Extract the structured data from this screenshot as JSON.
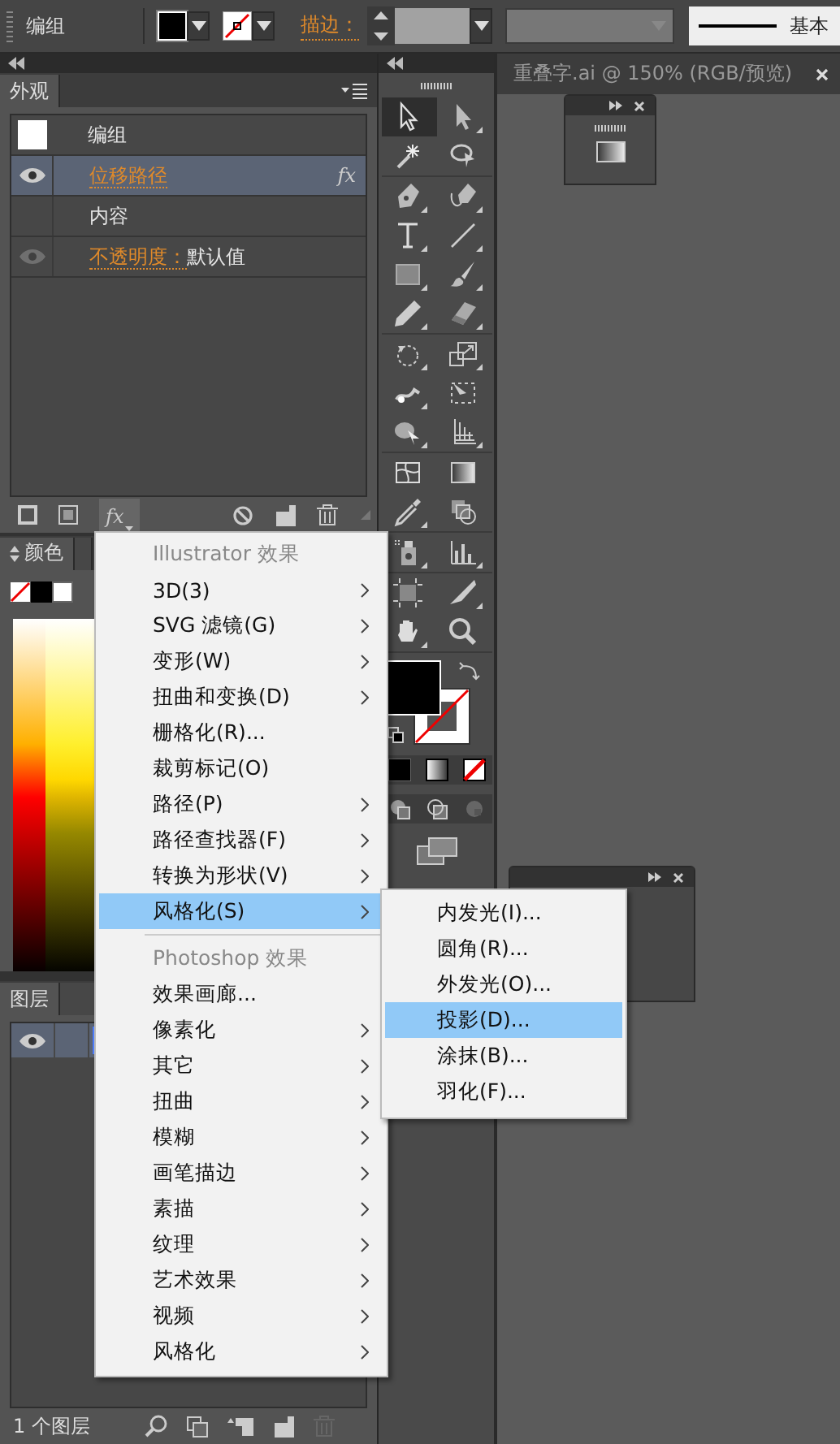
{
  "control_bar": {
    "selection_label": "编组",
    "stroke_label": "描边：",
    "stroke_style_label": "基本"
  },
  "appearance_panel": {
    "tab": "外观",
    "rows": [
      {
        "kind": "group",
        "label": "编组",
        "selected": false
      },
      {
        "kind": "effect",
        "label": "位移路径",
        "fx": "fx",
        "eye_dimmed": false,
        "selected": true
      },
      {
        "kind": "contents",
        "label": "内容",
        "selected": false
      },
      {
        "kind": "opacity",
        "label": "不透明度：",
        "value": "默认值",
        "eye_dimmed": true,
        "selected": false
      }
    ],
    "fx_button": "fx"
  },
  "color_panel": {
    "tab": "颜色"
  },
  "layers_panel": {
    "tab": "图层",
    "rows": [
      {
        "selected": true
      }
    ],
    "count": "1 个图层"
  },
  "toolbar": {
    "groups": [
      [
        {
          "kind": "selection",
          "selected": true,
          "flyout": false
        },
        {
          "kind": "direct-selection",
          "selected": false,
          "flyout": true
        },
        {
          "kind": "magic-wand",
          "selected": false,
          "flyout": false
        },
        {
          "kind": "lasso",
          "selected": false,
          "flyout": false
        }
      ],
      [
        {
          "kind": "pen",
          "selected": false,
          "flyout": true
        },
        {
          "kind": "curvature",
          "selected": false,
          "flyout": true
        },
        {
          "kind": "type",
          "selected": false,
          "flyout": true
        },
        {
          "kind": "line",
          "selected": false,
          "flyout": true
        },
        {
          "kind": "rectangle",
          "selected": false,
          "flyout": true
        },
        {
          "kind": "paintbrush",
          "selected": false,
          "flyout": true
        },
        {
          "kind": "pencil",
          "selected": false,
          "flyout": true
        },
        {
          "kind": "eraser",
          "selected": false,
          "flyout": true
        }
      ],
      [
        {
          "kind": "rotate",
          "selected": false,
          "flyout": true
        },
        {
          "kind": "scale",
          "selected": false,
          "flyout": true
        },
        {
          "kind": "width",
          "selected": false,
          "flyout": true
        },
        {
          "kind": "free-transform",
          "selected": false,
          "flyout": false
        },
        {
          "kind": "shape-builder",
          "selected": false,
          "flyout": true
        },
        {
          "kind": "perspective",
          "selected": false,
          "flyout": true
        }
      ],
      [
        {
          "kind": "mesh",
          "selected": false,
          "flyout": false
        },
        {
          "kind": "gradient",
          "selected": false,
          "flyout": false
        },
        {
          "kind": "eyedropper",
          "selected": false,
          "flyout": true
        },
        {
          "kind": "blend",
          "selected": false,
          "flyout": false
        }
      ],
      [
        {
          "kind": "sprayer",
          "selected": false,
          "flyout": true
        },
        {
          "kind": "column-graph",
          "selected": false,
          "flyout": true
        }
      ],
      [
        {
          "kind": "artboard",
          "selected": false,
          "flyout": false
        },
        {
          "kind": "slice",
          "selected": false,
          "flyout": true
        },
        {
          "kind": "hand",
          "selected": false,
          "flyout": true
        },
        {
          "kind": "zoom",
          "selected": false,
          "flyout": false
        }
      ]
    ]
  },
  "document": {
    "tab_title": "重叠字.ai @ 150% (RGB/预览)"
  },
  "effects_menu": {
    "sections": [
      {
        "header": "Illustrator 效果",
        "items": [
          {
            "label": "3D(3)",
            "submenu": true,
            "selected": false
          },
          {
            "label": "SVG 滤镜(G)",
            "submenu": true,
            "selected": false
          },
          {
            "label": "变形(W)",
            "submenu": true,
            "selected": false
          },
          {
            "label": "扭曲和变换(D)",
            "submenu": true,
            "selected": false
          },
          {
            "label": "栅格化(R)...",
            "submenu": false,
            "selected": false
          },
          {
            "label": "裁剪标记(O)",
            "submenu": false,
            "selected": false
          },
          {
            "label": "路径(P)",
            "submenu": true,
            "selected": false
          },
          {
            "label": "路径查找器(F)",
            "submenu": true,
            "selected": false
          },
          {
            "label": "转换为形状(V)",
            "submenu": true,
            "selected": false
          },
          {
            "label": "风格化(S)",
            "submenu": true,
            "selected": true
          }
        ]
      },
      {
        "header": "Photoshop 效果",
        "items": [
          {
            "label": "效果画廊...",
            "submenu": false,
            "selected": false
          },
          {
            "label": "像素化",
            "submenu": true,
            "selected": false
          },
          {
            "label": "其它",
            "submenu": true,
            "selected": false
          },
          {
            "label": "扭曲",
            "submenu": true,
            "selected": false
          },
          {
            "label": "模糊",
            "submenu": true,
            "selected": false
          },
          {
            "label": "画笔描边",
            "submenu": true,
            "selected": false
          },
          {
            "label": "素描",
            "submenu": true,
            "selected": false
          },
          {
            "label": "纹理",
            "submenu": true,
            "selected": false
          },
          {
            "label": "艺术效果",
            "submenu": true,
            "selected": false
          },
          {
            "label": "视频",
            "submenu": true,
            "selected": false
          },
          {
            "label": "风格化",
            "submenu": true,
            "selected": false
          }
        ]
      }
    ]
  },
  "stylize_submenu": {
    "items": [
      {
        "label": "内发光(I)...",
        "selected": false
      },
      {
        "label": "圆角(R)...",
        "selected": false
      },
      {
        "label": "外发光(O)...",
        "selected": false
      },
      {
        "label": "投影(D)...",
        "selected": true
      },
      {
        "label": "涂抹(B)...",
        "selected": false
      },
      {
        "label": "羽化(F)...",
        "selected": false
      }
    ]
  }
}
